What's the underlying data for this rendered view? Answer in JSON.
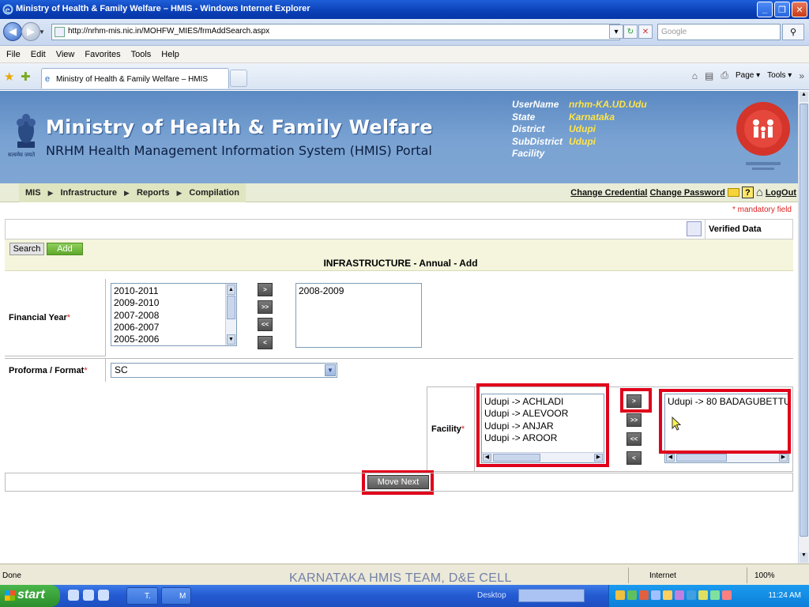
{
  "window": {
    "title": "Ministry of Health & Family Welfare – HMIS - Windows Internet Explorer",
    "buttons": [
      "_",
      "❐",
      "✕"
    ]
  },
  "browser": {
    "url": "http://nrhm-mis.nic.in/MOHFW_MIES/frmAddSearch.aspx",
    "search_placeholder": "Google",
    "menu": [
      "File",
      "Edit",
      "View",
      "Favorites",
      "Tools",
      "Help"
    ],
    "tab_title": "Ministry of Health & Family Welfare – HMIS",
    "cmd_page": "Page ▾",
    "cmd_tools": "Tools ▾"
  },
  "header": {
    "title": "Ministry of Health & Family Welfare",
    "subtitle": "NRHM Health Management Information System (HMIS) Portal",
    "emblem_caption": "सत्यमेव जयते",
    "user": [
      {
        "label": "UserName",
        "value": "nrhm-KA.UD.Udu"
      },
      {
        "label": "State",
        "value": "Karnataka"
      },
      {
        "label": "District",
        "value": "Udupi"
      },
      {
        "label": "SubDistrict",
        "value": "Udupi"
      },
      {
        "label": "Facility",
        "value": ""
      }
    ]
  },
  "nav": {
    "items": [
      "MIS",
      "Infrastructure",
      "Reports",
      "Compilation"
    ],
    "change_credential": "Change Credential",
    "change_password": "Change Password",
    "logout": "LogOut"
  },
  "form": {
    "mandatory_note": "* mandatory field",
    "verified_label": "Verified Data",
    "search_btn": "Search",
    "add_btn": "Add",
    "heading": "INFRASTRUCTURE - Annual - Add",
    "fy_label": "Financial Year",
    "fy_available": [
      "2010-2011",
      "2009-2010",
      "2007-2008",
      "2006-2007",
      "2005-2006"
    ],
    "fy_selected": [
      "2008-2009"
    ],
    "proforma_label": "Proforma / Format",
    "proforma_value": "SC",
    "facility_label": "Facility",
    "facility_available": [
      "Udupi -> ACHLADI",
      "Udupi -> ALEVOOR",
      "Udupi -> ANJAR",
      "Udupi -> AROOR"
    ],
    "facility_selected": [
      "Udupi -> 80 BADAGUBETTU"
    ],
    "move_buttons": [
      ">",
      ">>",
      "<<",
      "<"
    ],
    "move_next": "Move Next",
    "required_mark": "*"
  },
  "status": {
    "text": "Done",
    "watermark": "KARNATAKA HMIS TEAM, D&E CELL",
    "zone": "Internet",
    "zoom": "100%"
  },
  "taskbar": {
    "start": "start",
    "tasks": [
      "T.",
      "M"
    ],
    "desktop": "Desktop",
    "clock": "11:24 AM"
  },
  "colors": {
    "banner": "#5b89c2",
    "highlight": "#e0001b",
    "user_value": "#ffe44a",
    "add_green": "#6cb43a"
  }
}
